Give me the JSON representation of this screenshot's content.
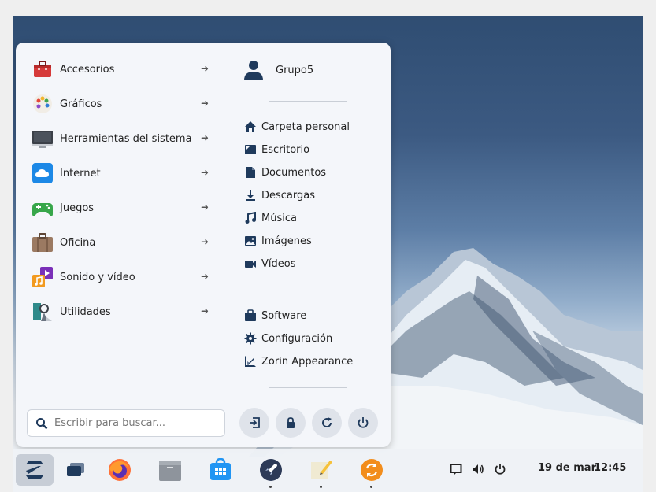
{
  "menu": {
    "categories": [
      {
        "label": "Accesorios"
      },
      {
        "label": "Gráficos"
      },
      {
        "label": "Herramientas del sistema"
      },
      {
        "label": "Internet"
      },
      {
        "label": "Juegos"
      },
      {
        "label": "Oficina"
      },
      {
        "label": "Sonido y vídeo"
      },
      {
        "label": "Utilidades"
      }
    ],
    "user": {
      "name": "Grupo5"
    },
    "places": [
      {
        "label": "Carpeta personal",
        "icon": "home-icon"
      },
      {
        "label": "Escritorio",
        "icon": "desktop-icon"
      },
      {
        "label": "Documentos",
        "icon": "document-icon"
      },
      {
        "label": "Descargas",
        "icon": "download-icon"
      },
      {
        "label": "Música",
        "icon": "music-icon"
      },
      {
        "label": "Imágenes",
        "icon": "image-icon"
      },
      {
        "label": "Vídeos",
        "icon": "video-icon"
      }
    ],
    "apps": [
      {
        "label": "Software",
        "icon": "briefcase-icon"
      },
      {
        "label": "Configuración",
        "icon": "gear-icon"
      },
      {
        "label": "Zorin Appearance",
        "icon": "zorin-appearance-icon"
      }
    ],
    "search": {
      "placeholder": "Escribir para buscar..."
    }
  },
  "taskbar": {
    "date": "19 de mar",
    "time": "12:45"
  },
  "colors": {
    "menu_bg": "#f4f6fa",
    "icon_dark": "#1f3a5c",
    "accent_blue": "#1c88e6",
    "taskbar_bg": "#eef1f6"
  }
}
